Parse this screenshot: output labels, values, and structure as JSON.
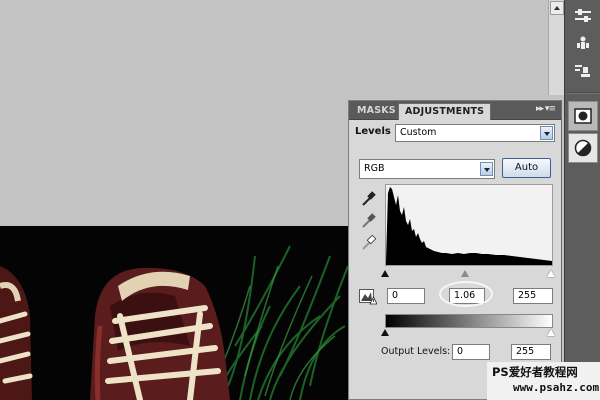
{
  "panel": {
    "tabs": [
      "MASKS",
      "ADJUSTMENTS"
    ],
    "menu_glyph": "▸▸ ▾≡",
    "levels_label": "Levels",
    "preset_value": "Custom",
    "channel_value": "RGB",
    "auto_label": "Auto",
    "input_black": "0",
    "input_gamma": "1.06",
    "input_white": "255",
    "output_label": "Output Levels:",
    "output_black": "0",
    "output_white": "255"
  },
  "dock": {
    "icons": [
      "sliders-icon",
      "puppet-icon",
      "clone-source-icon",
      "mask-icon",
      "adjustment-icon"
    ]
  },
  "watermark": {
    "line1": "PS爱好者教程网",
    "line2": "www.psahz.com"
  },
  "chart_data": {
    "type": "histogram",
    "channel": "RGB",
    "input_levels": [
      0,
      1.06,
      255
    ],
    "output_levels": [
      0,
      255
    ]
  },
  "colors": {
    "panel_bg": "#d8d8d8",
    "tab_bar": "#5a5a5a",
    "dock_bg": "#5d5d5d",
    "canvas_gray": "#c3c3c3"
  }
}
